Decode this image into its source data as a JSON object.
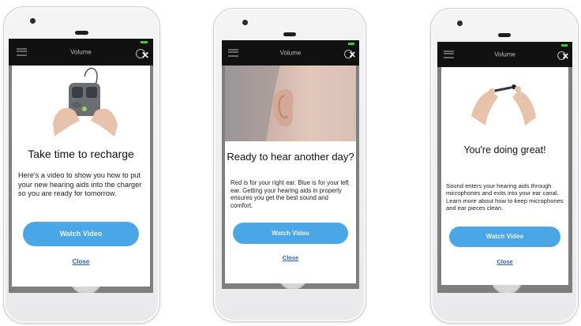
{
  "phones": [
    {
      "topbar": {
        "title": "Volume"
      },
      "heading": "Take time to recharge",
      "body": "Here's a video to show you how to put your new hearing aids into the charger so you are ready for tomorrow.",
      "button": "Watch Video",
      "close": "Close"
    },
    {
      "topbar": {
        "title": "Volume"
      },
      "heading": "Ready to hear another day?",
      "body": "Red is for your right ear. Blue is for your left ear. Getting your hearing aids in properly ensures you get the best sound and comfort.",
      "button": "Watch Video",
      "close": "Close"
    },
    {
      "topbar": {
        "title": "Volume"
      },
      "heading": "You're doing great!",
      "body": "Sound enters your hearing aids through microphones and exits into your ear canal. Learn more about how to keep microphones and ear pieces clean.",
      "button": "Watch Video",
      "close": "Close"
    }
  ],
  "colors": {
    "accent": "#4aa6e6",
    "topbar": "#111111",
    "battery": "#3ec63e",
    "link": "#2b5fae"
  },
  "icons": [
    "menu-icon",
    "info-icon",
    "close-icon",
    "battery-icon"
  ]
}
